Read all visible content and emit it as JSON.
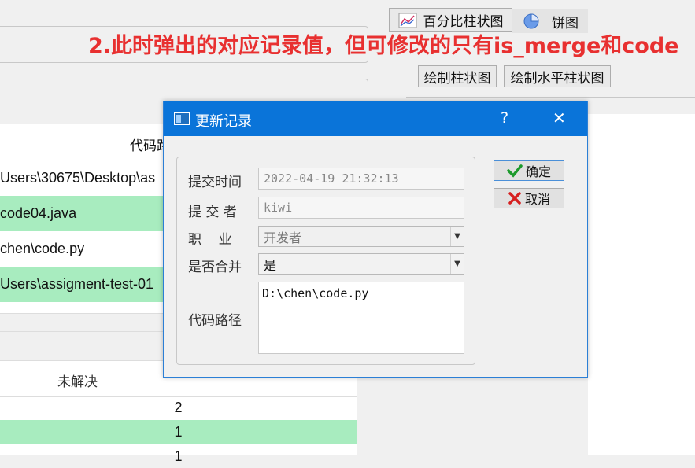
{
  "background": {
    "table_header": "代码路",
    "table_rows": [
      {
        "text": "Users\\30675\\Desktop\\as",
        "highlight": false
      },
      {
        "text": "code04.java",
        "highlight": true
      },
      {
        "text": "chen\\code.py",
        "highlight": false
      },
      {
        "text": "Users\\assigment-test-01",
        "highlight": true
      }
    ],
    "stats_header": "未解决",
    "stats_rows": [
      {
        "value": "2",
        "highlight": false
      },
      {
        "value": "1",
        "highlight": true
      },
      {
        "value": "1",
        "highlight": false
      }
    ],
    "chart_buttons": {
      "percent_bar": "百分比柱状图",
      "pie": "饼图",
      "bar": "绘制柱状图",
      "hbar": "绘制水平柱状图"
    }
  },
  "annotation": "2.此时弹出的对应记录值，但可修改的只有is_merge和code",
  "dialog": {
    "title": "更新记录",
    "help": "?",
    "close": "✕",
    "labels": {
      "time": "提交时间",
      "committer": "提 交 者",
      "job": "职    业",
      "merge": "是否合并",
      "path": "代码路径"
    },
    "values": {
      "time": "2022-04-19 21:32:13",
      "committer": "kiwi",
      "job": "开发者",
      "merge": "是",
      "path": "D:\\chen\\code.py"
    },
    "ok": "确定",
    "cancel": "取消"
  },
  "colors": {
    "accent": "#0a74d9",
    "row_highlight": "#a8ecbf",
    "annotation": "#e83030"
  }
}
